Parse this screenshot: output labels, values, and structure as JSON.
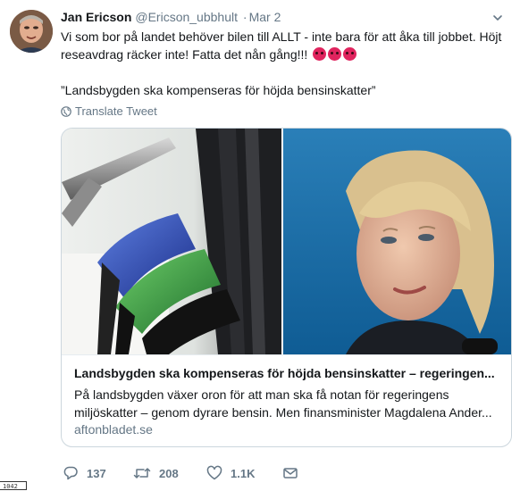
{
  "tweet": {
    "author_name": "Jan Ericson",
    "author_handle": "@Ericson_ubbhult",
    "separator": "·",
    "date": "Mar 2",
    "body_line": "Vi som bor på landet behöver bilen till ALLT - inte bara för att åka till jobbet. Höjt reseavdrag räcker inte! Fatta det nån gång!!!",
    "emoji_names": [
      "angry-face-icon",
      "angry-face-icon",
      "angry-face-icon"
    ],
    "quote": "”Landsbygden ska kompenseras för höjda bensinskatter”",
    "translate_label": "Translate Tweet"
  },
  "card": {
    "title": "Landsbygden ska kompenseras för höjda bensinskatter – regeringen...",
    "desc_line1": "På landsbygden växer oron för att man ska få notan för regeringens",
    "desc_line2": "miljöskatter – genom dyrare bensin. Men finansminister Magdalena Ander...",
    "domain": "aftonbladet.se"
  },
  "actions": {
    "replies": "137",
    "retweets": "208",
    "likes": "1.1K"
  },
  "corner_tag": "1042",
  "colors": {
    "text": "#14171a",
    "muted": "#657786",
    "border": "#ccd6dd",
    "emoji": "#e0245e"
  }
}
